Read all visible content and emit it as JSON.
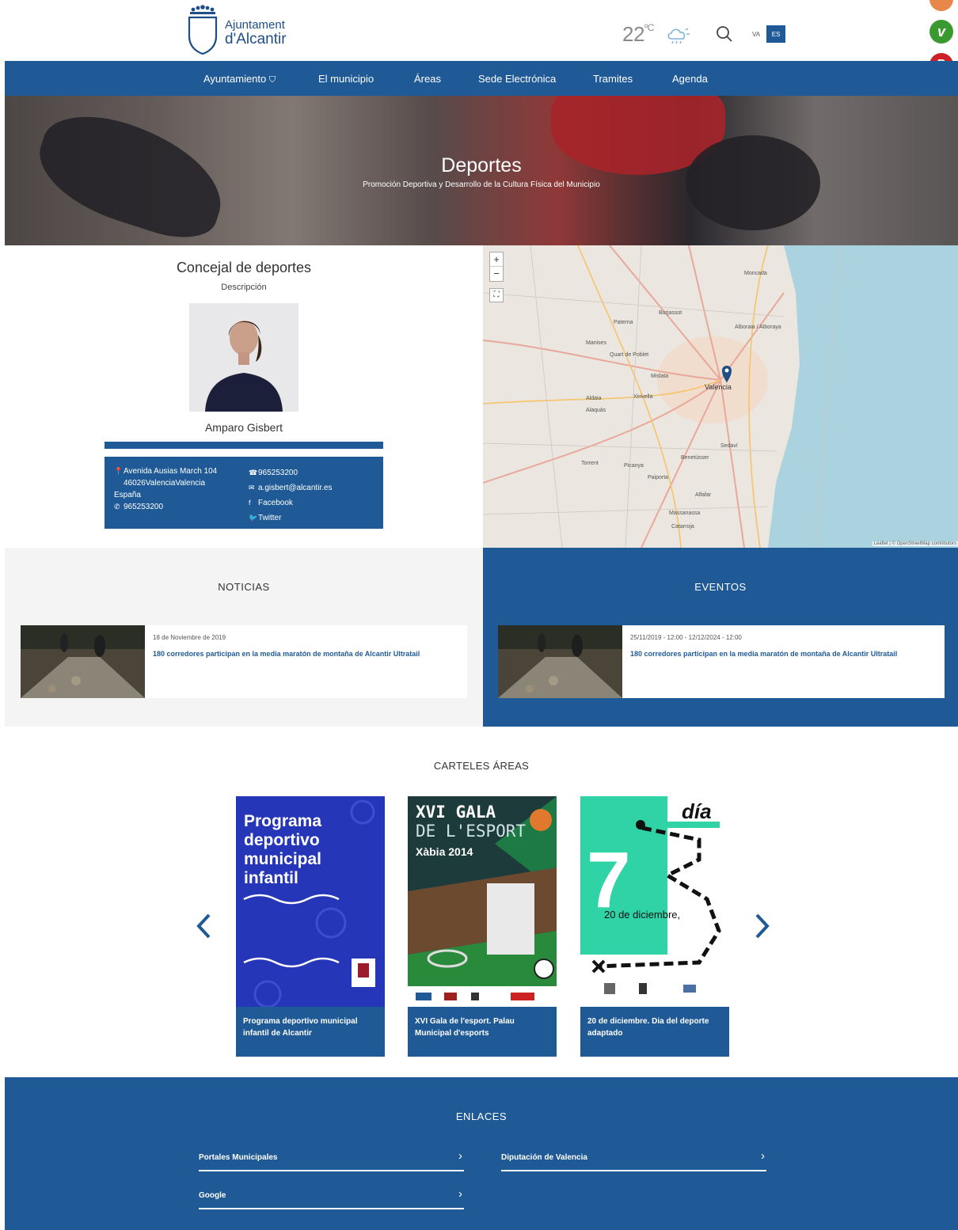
{
  "header": {
    "logo_line1": "Ajuntament",
    "logo_line2": "d'Alcantir",
    "temperature": "22",
    "temperature_unit": "ºC",
    "weather_icon": "cloud-sun-icon",
    "lang_va": "VA",
    "lang_es": "ES"
  },
  "social": [
    {
      "name": "vimeo-icon",
      "glyph": "v",
      "color": "#3b9a2f"
    },
    {
      "name": "pinterest-icon",
      "glyph": "P",
      "color": "#cc1f26"
    },
    {
      "name": "link-icon",
      "glyph": "🔗",
      "color": "#1f5a96"
    }
  ],
  "nav": {
    "items": [
      "Ayuntamiento",
      "El municipio",
      "Áreas",
      "Sede Electrónica",
      "Tramites",
      "Agenda"
    ]
  },
  "hero": {
    "title": "Deportes",
    "subtitle": "Promoción Deportiva y Desarrollo de la Cultura Física del Municipio"
  },
  "concejal": {
    "title": "Concejal de deportes",
    "desc": "Descripción",
    "name": "Amparo Gisbert",
    "address1": "Avenida Ausias March 104",
    "address2": "46026ValenciaValencia",
    "address3": "España",
    "phone": "965253200",
    "phone2": "965253200",
    "email": "a.gisbert@alcantir.es",
    "facebook": "Facebook",
    "twitter": "Twitter"
  },
  "map": {
    "attribution": "Leaflet | © OpenStreetMap contributors",
    "zoom_in": "+",
    "zoom_out": "−",
    "labels": [
      "Valencia",
      "Paterna",
      "Burjassot",
      "Mislata",
      "Alaquàs",
      "Torrent",
      "Picanya",
      "Alfafar",
      "Quart de Poblet",
      "Xirivella",
      "Manises",
      "Moncada",
      "Alboraia / Alboraya",
      "Benetússer",
      "Catarroja",
      "Massanassa",
      "Sedaví",
      "Paiporta",
      "Aldaia"
    ]
  },
  "noticias": {
    "title": "NOTICIAS",
    "date": "18 de Noviembre de 2019",
    "headline": "180 corredores participan en la media maratón de montaña de Alcantir Ultratail"
  },
  "eventos": {
    "title": "EVENTOS",
    "date": "25/11/2019 - 12:00 - 12/12/2024 - 12:00",
    "headline": "180 corredores participan en la media maratón de montaña de Alcantir Ultratail"
  },
  "carteles": {
    "title": "CARTELES ÁREAS",
    "posters": [
      {
        "caption": "Programa deportivo municipal infantil de Alcantir",
        "heading": "Programa deportivo municipal infantil"
      },
      {
        "caption": "XVI Gala de l'esport. Palau Municipal d'esports",
        "heading_a": "XVI GALA",
        "heading_b": "DE L'ESPORT",
        "heading_c": "Xàbia 2014"
      },
      {
        "caption": "20 de diciembre. Dia del deporte adaptado",
        "heading": "día",
        "date": "20 de diciembre,",
        "num": "7"
      }
    ]
  },
  "enlaces": {
    "title": "ENLACES",
    "links": [
      "Portales Municipales",
      "Diputación de Valencia",
      "Google"
    ]
  },
  "colors": {
    "brand_blue": "#1f5a96"
  }
}
